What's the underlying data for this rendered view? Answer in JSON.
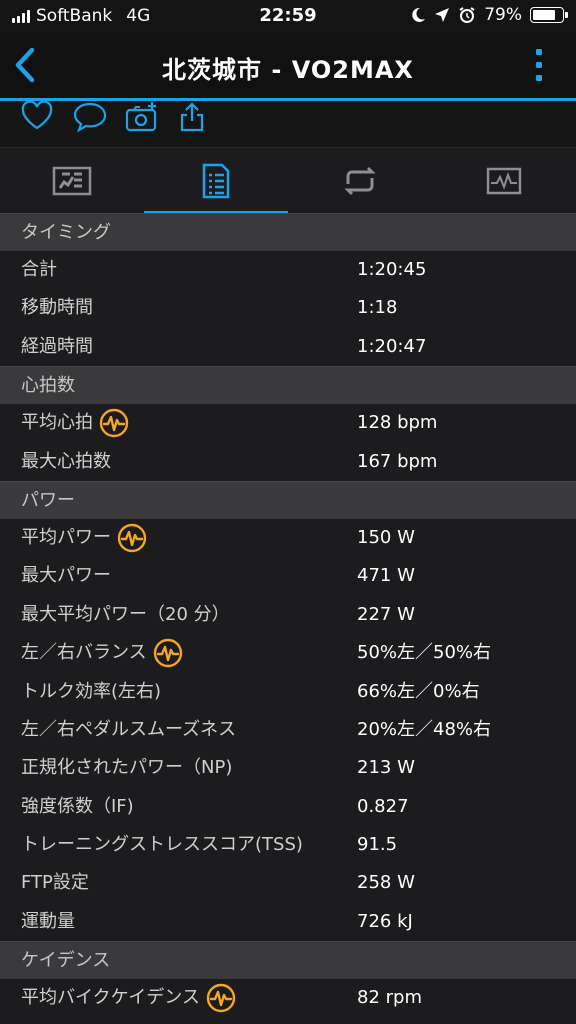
{
  "status": {
    "carrier": "SoftBank",
    "network": "4G",
    "time": "22:59",
    "battery_percent": "79%",
    "battery_level": 0.79
  },
  "nav": {
    "title": "北茨城市 - VO2MAX",
    "accent_color": "#1aa3e8"
  },
  "actions": [
    "heart-icon",
    "comment-icon",
    "add-photo-icon",
    "share-icon"
  ],
  "tabs": [
    {
      "icon": "summary-chart-icon",
      "active": false
    },
    {
      "icon": "details-list-icon",
      "active": true
    },
    {
      "icon": "laps-icon",
      "active": false
    },
    {
      "icon": "graph-icon",
      "active": false
    }
  ],
  "sections": [
    {
      "title": "タイミング",
      "rows": [
        {
          "label": "合計",
          "value": "1:20:45",
          "badge": false
        },
        {
          "label": "移動時間",
          "value": "1:18",
          "badge": false
        },
        {
          "label": "経過時間",
          "value": "1:20:47",
          "badge": false
        }
      ]
    },
    {
      "title": "心拍数",
      "rows": [
        {
          "label": "平均心拍",
          "value": "128 bpm",
          "badge": true
        },
        {
          "label": "最大心拍数",
          "value": "167 bpm",
          "badge": false
        }
      ]
    },
    {
      "title": "パワー",
      "rows": [
        {
          "label": "平均パワー",
          "value": "150 W",
          "badge": true
        },
        {
          "label": "最大パワー",
          "value": "471 W",
          "badge": false
        },
        {
          "label": "最大平均パワー（20 分）",
          "value": "227 W",
          "badge": false
        },
        {
          "label": "左／右バランス",
          "value": "50%左／50%右",
          "badge": true
        },
        {
          "label": "トルク効率(左右)",
          "value": "66%左／0%右",
          "badge": false
        },
        {
          "label": "左／右ペダルスムーズネス",
          "value": "20%左／48%右",
          "badge": false
        },
        {
          "label": "正規化されたパワー（NP)",
          "value": "213 W",
          "badge": false
        },
        {
          "label": "強度係数（IF)",
          "value": "0.827",
          "badge": false
        },
        {
          "label": "トレーニングストレススコア(TSS)",
          "value": "91.5",
          "badge": false
        },
        {
          "label": "FTP設定",
          "value": "258 W",
          "badge": false
        },
        {
          "label": "運動量",
          "value": "726 kJ",
          "badge": false
        }
      ]
    },
    {
      "title": "ケイデンス",
      "rows": [
        {
          "label": "平均バイクケイデンス",
          "value": "82 rpm",
          "badge": true
        }
      ]
    }
  ],
  "badge_color": "#f5a623"
}
